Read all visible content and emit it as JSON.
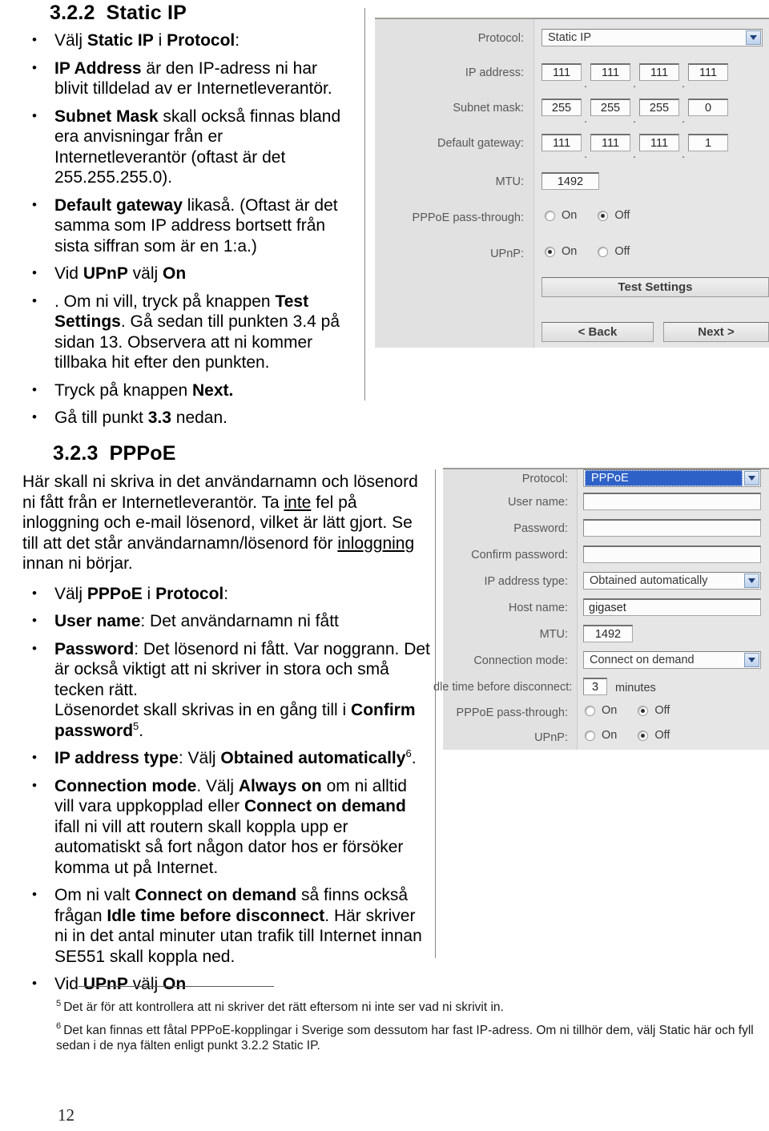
{
  "document": {
    "page_number": "12"
  },
  "section_322": {
    "heading_number": "3.2.2",
    "heading_title": "Static IP",
    "bullets": [
      {
        "id": "valj-static-ip",
        "html": "Välj <b>Static IP</b> i <b>Protocol</b>:"
      },
      {
        "id": "ip-address",
        "html": "<b>IP Address</b> är den IP-adress ni har blivit tilldelad av er Internetleverantör."
      },
      {
        "id": "subnet-mask",
        "html": "<b>Subnet Mask</b> skall också finnas bland era anvisningar från er Internetleverantör (oftast är det 255.255.255.0)."
      },
      {
        "id": "default-gateway",
        "html": "<b>Default gateway</b> likaså. (Oftast är det samma som IP address bortsett från sista siffran som är en 1:a.)"
      },
      {
        "id": "upnp",
        "html": "Vid <b>UPnP</b> välj <b>On</b>"
      },
      {
        "id": "test-settings",
        "html": ". Om ni vill, tryck på knappen <b>Test Settings</b>. Gå sedan till punkten 3.4 på sidan 13. Observera att ni kommer tillbaka hit efter den punkten."
      },
      {
        "id": "next",
        "html": "Tryck på knappen <b>Next.</b>"
      },
      {
        "id": "goto-33",
        "html": "Gå till punkt <b>3.3</b> nedan."
      }
    ]
  },
  "section_323": {
    "heading_number": "3.2.3",
    "heading_title": "PPPoE",
    "intro_html": "Här skall ni skriva in det användarnamn och lösenord ni fått från er Internetleverantör. Ta <u>inte</u> fel på inloggning och e-mail lösenord, vilket är lätt gjort. Se till att det står användarnamn/lösenord för <u>inloggning</u> innan ni börjar.",
    "bullets": [
      {
        "id": "valj-pppoe",
        "html": "Välj <b>PPPoE</b> i <b>Protocol</b>:"
      },
      {
        "id": "user-name",
        "html": "<b>User name</b>: Det användarnamn ni fått"
      },
      {
        "id": "password",
        "html": "<b>Password</b>: Det lösenord ni fått. Var noggrann. Det är också viktigt att ni skriver in stora och små tecken rätt.<br>Lösenordet skall skrivas in en gång till i <b>Confirm password</b><sup>5</sup>."
      },
      {
        "id": "ip-address-type",
        "html": "<b>IP address type</b>: Välj <b>Obtained automatically</b><sup>6</sup>."
      },
      {
        "id": "connection-mode",
        "html": "<b>Connection mode</b>. Välj <b>Always on</b> om ni alltid vill vara uppkopplad eller <b>Connect on demand</b> ifall ni vill att routern skall koppla upp er automatiskt så fort någon dator hos er försöker komma ut på Internet."
      },
      {
        "id": "idle-time",
        "html": "Om ni valt <b>Connect on demand</b> så finns också frågan <b>Idle time before disconnect</b>. Här skriver ni in det antal minuter utan trafik till Internet innan SE551 skall koppla ned."
      },
      {
        "id": "upnp-2",
        "html": "Vid <b>UPnP</b> välj <b>On</b>"
      }
    ]
  },
  "footnotes": [
    {
      "marker": "5",
      "text": "Det är för att kontrollera att ni skriver det rätt eftersom ni inte ser vad ni skrivit in."
    },
    {
      "marker": "6",
      "text": "Det kan finnas ett fåtal PPPoE-kopplingar i Sverige som dessutom har fast IP-adress. Om ni tillhör dem, välj Static här och fyll sedan i de nya fälten enligt punkt 3.2.2 Static IP."
    }
  ],
  "screenshot_static_ip": {
    "labels": {
      "protocol": "Protocol:",
      "ip_address": "IP address:",
      "subnet_mask": "Subnet mask:",
      "default_gateway": "Default gateway:",
      "mtu": "MTU:",
      "pppoe_passthrough": "PPPoE pass-through:",
      "upnp": "UPnP:"
    },
    "protocol_value": "Static IP",
    "ip_address_octets": [
      "111",
      "111",
      "111",
      "111"
    ],
    "subnet_mask_octets": [
      "255",
      "255",
      "255",
      "0"
    ],
    "default_gateway_octets": [
      "111",
      "111",
      "111",
      "1"
    ],
    "mtu_value": "1492",
    "radio_on": "On",
    "radio_off": "Off",
    "pppoe_passthrough_selected": "Off",
    "upnp_selected": "On",
    "test_settings_button": "Test Settings",
    "back_button": "< Back",
    "next_button": "Next >"
  },
  "screenshot_pppoe": {
    "labels": {
      "protocol": "Protocol:",
      "user_name": "User name:",
      "password": "Password:",
      "confirm_password": "Confirm password:",
      "ip_address_type": "IP address type:",
      "host_name": "Host name:",
      "mtu": "MTU:",
      "connection_mode": "Connection mode:",
      "idle_time": "dle time before disconnect:",
      "pppoe_passthrough": "PPPoE pass-through:",
      "upnp": "UPnP:"
    },
    "protocol_value": "PPPoE",
    "user_name_value": "",
    "password_value": "",
    "confirm_password_value": "",
    "ip_address_type_value": "Obtained automatically",
    "host_name_value": "gigaset",
    "mtu_value": "1492",
    "connection_mode_value": "Connect on demand",
    "idle_time_value": "3",
    "idle_time_unit": "minutes",
    "radio_on": "On",
    "radio_off": "Off",
    "pppoe_passthrough_selected": "Off",
    "upnp_selected": "Off"
  },
  "colors": {
    "selection_blue": "#2a5fc8",
    "dialog_gray": "#e8e8e8",
    "label_col_gray": "#e3e3e3"
  }
}
